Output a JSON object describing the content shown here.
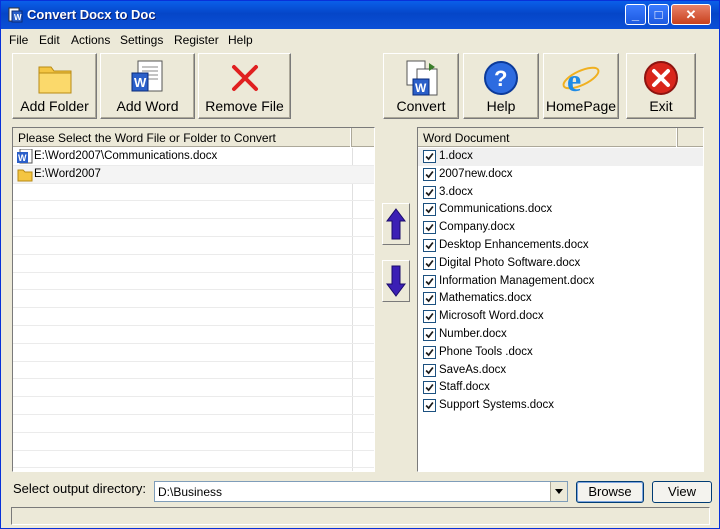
{
  "window": {
    "title": "Convert Docx to Doc"
  },
  "menu": [
    "File",
    "Edit",
    "Actions",
    "Settings",
    "Register",
    "Help"
  ],
  "toolbar": {
    "add_folder": "Add Folder",
    "add_word": "Add Word",
    "remove_file": "Remove File",
    "convert": "Convert",
    "help": "Help",
    "homepage": "HomePage",
    "exit": "Exit"
  },
  "left_panel": {
    "header": "Please Select the Word File or Folder to Convert",
    "items": [
      "E:\\Word2007\\Communications.docx",
      "E:\\Word2007"
    ]
  },
  "right_panel": {
    "header": "Word Document",
    "items": [
      "1.docx",
      "2007new.docx",
      "3.docx",
      "Communications.docx",
      "Company.docx",
      "Desktop Enhancements.docx",
      "Digital Photo Software.docx",
      "Information Management.docx",
      "Mathematics.docx",
      "Microsoft Word.docx",
      "Number.docx",
      "Phone Tools .docx",
      "SaveAs.docx",
      "Staff.docx",
      "Support Systems.docx"
    ]
  },
  "output": {
    "label": "Select  output directory:",
    "value": "D:\\Business",
    "browse": "Browse",
    "view": "View"
  }
}
